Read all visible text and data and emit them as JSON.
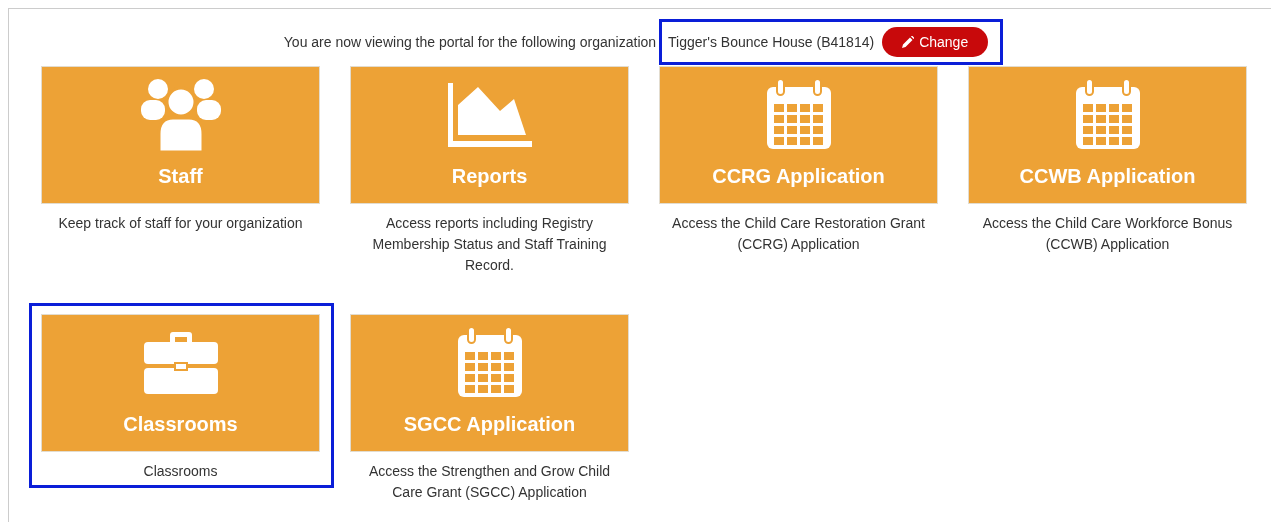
{
  "banner": {
    "text": "You are now viewing the portal for the following organization",
    "organization": "Tigger's Bounce House (B41814)",
    "change_button": "Change",
    "highlighted": true
  },
  "tiles": [
    {
      "title": "Staff",
      "kind": "people",
      "description": "Keep track of staff for your organization",
      "highlighted": false
    },
    {
      "title": "Reports",
      "kind": "chart",
      "description": "Access reports including Registry Membership Status and Staff Training Record.",
      "highlighted": false
    },
    {
      "title": "CCRG Application",
      "kind": "calendar",
      "description": "Access the Child Care Restoration Grant (CCRG) Application",
      "highlighted": false
    },
    {
      "title": "CCWB Application",
      "kind": "calendar",
      "description": "Access the Child Care Workforce Bonus (CCWB) Application",
      "highlighted": false
    },
    {
      "title": "Classrooms",
      "kind": "briefcase",
      "description": "Classrooms",
      "highlighted": true
    },
    {
      "title": "SGCC Application",
      "kind": "calendar",
      "description": "Access the Strengthen and Grow Child Care Grant (SGCC) Application",
      "highlighted": false
    }
  ]
}
